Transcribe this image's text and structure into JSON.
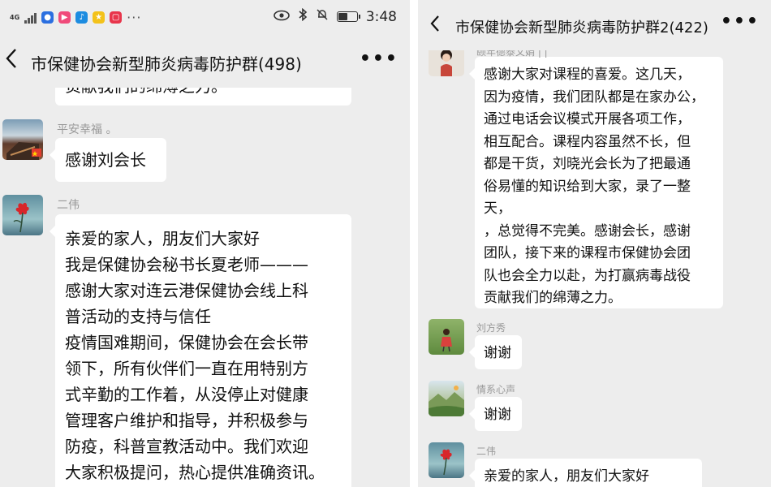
{
  "status_bar": {
    "network": "4G",
    "time": "3:48",
    "battery_level": 0.55
  },
  "left_chat": {
    "title": "市保健协会新型肺炎病毒防护群(498)",
    "back_icon": "back-chevron-icon",
    "more_icon": "more-dots-icon",
    "cut_message_text": "贡献我们的绵薄之力。",
    "messages": [
      {
        "sender": "平安幸福 。",
        "lines": [
          "感谢刘会长"
        ]
      },
      {
        "sender": "二伟",
        "lines": [
          "亲爱的家人，朋友们大家好",
          "我是保健协会秘书长夏老师———",
          "感谢大家对连云港保健协会线上科",
          "普活动的支持与信任",
          "疫情国难期间，保健协会在会长带",
          "领下，所有伙伴们一直在用特别方",
          "式辛勤的工作着，从没停止对健康",
          "管理客户维护和指导，并积极参与",
          "防疫，科普宣教活动中。我们欢迎",
          "大家积极提问，热心提供准确资讯。"
        ]
      }
    ]
  },
  "right_chat": {
    "title": "市保健协会新型肺炎病毒防护群2(422)",
    "back_icon": "back-chevron-icon",
    "more_icon": "more-dots-icon",
    "cut_sender": "颐年德泰文娟 | |",
    "messages": [
      {
        "sender": "",
        "lines": [
          "感谢大家对课程的喜爱。这几天，",
          "因为疫情，我们团队都是在家办公，",
          "通过电话会议模式开展各项工作，",
          "相互配合。课程内容虽然不长，但",
          "都是干货，刘晓光会长为了把最通",
          "俗易懂的知识给到大家，录了一整",
          "天，",
          "，总觉得不完美。感谢会长，感谢",
          "团队，接下来的课程市保健协会团",
          "队也会全力以赴，为打赢病毒战役",
          "贡献我们的绵薄之力。"
        ]
      },
      {
        "sender": "刘方秀",
        "lines": [
          "谢谢"
        ]
      },
      {
        "sender": "情系心声",
        "lines": [
          "谢谢"
        ]
      },
      {
        "sender": "二伟",
        "lines": [
          "亲爱的家人，朋友们大家好"
        ]
      }
    ]
  }
}
